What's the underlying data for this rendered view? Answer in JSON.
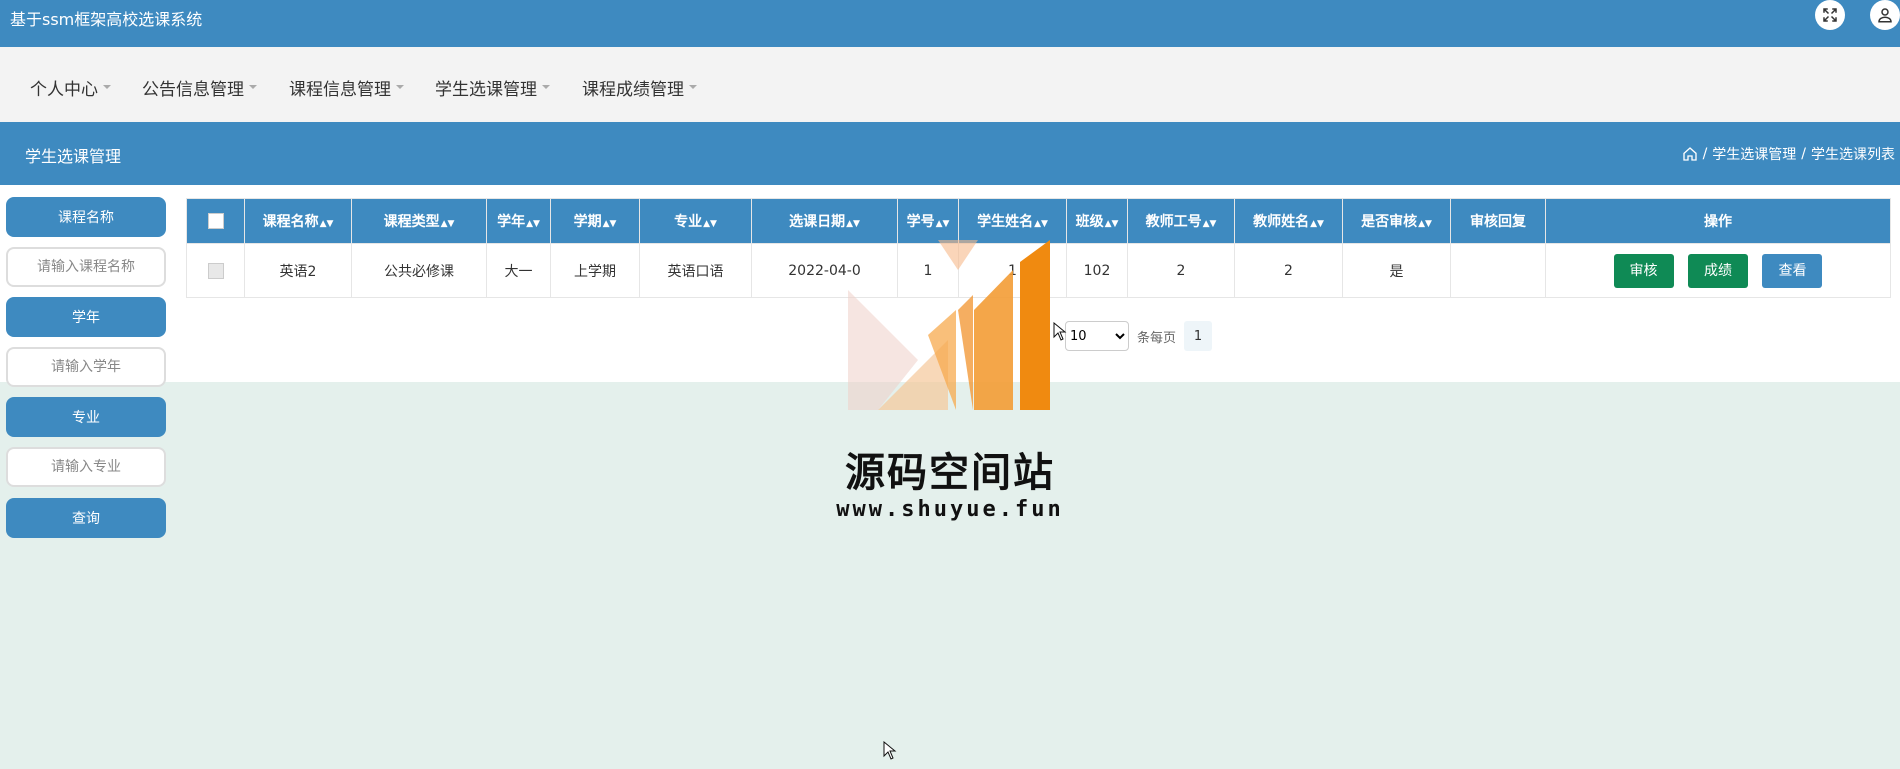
{
  "app": {
    "title": "基于ssm框架高校选课系统"
  },
  "icons": {
    "fullscreen": "expand-icon",
    "user": "user-icon",
    "home": "home-icon"
  },
  "nav": {
    "items": [
      {
        "label": "个人中心"
      },
      {
        "label": "公告信息管理"
      },
      {
        "label": "课程信息管理"
      },
      {
        "label": "学生选课管理"
      },
      {
        "label": "课程成绩管理"
      }
    ]
  },
  "section": {
    "title": "学生选课管理",
    "breadcrumb": [
      "学生选课管理",
      "学生选课列表"
    ],
    "separator": "/"
  },
  "search": {
    "course_label": "课程名称",
    "course_placeholder": "请输入课程名称",
    "year_label": "学年",
    "year_placeholder": "请输入学年",
    "major_label": "专业",
    "major_placeholder": "请输入专业",
    "query_label": "查询"
  },
  "table": {
    "columns": [
      "课程名称",
      "课程类型",
      "学年",
      "学期",
      "专业",
      "选课日期",
      "学号",
      "学生姓名",
      "班级",
      "教师工号",
      "教师姓名",
      "是否审核",
      "审核回复",
      "操作"
    ],
    "rows": [
      {
        "course": "英语2",
        "type": "公共必修课",
        "year": "大一",
        "term": "上学期",
        "major": "英语口语",
        "date": "2022-04-0",
        "student_no": "1",
        "student_name": "1",
        "class": "102",
        "teacher_no": "2",
        "teacher_name": "2",
        "audited": "是",
        "reply": "",
        "actions": [
          "审核",
          "成绩",
          "查看"
        ]
      }
    ]
  },
  "pager": {
    "page_size": "10",
    "per_page_label": "条每页",
    "current_page": "1"
  },
  "watermark": {
    "text": "源码空间站",
    "url": "www.shuyue.fun"
  },
  "colors": {
    "primary": "#3e8ac0",
    "success": "#0f8a55",
    "nav_bg": "#f3f3f3",
    "page_bg": "#e4f0ec"
  }
}
